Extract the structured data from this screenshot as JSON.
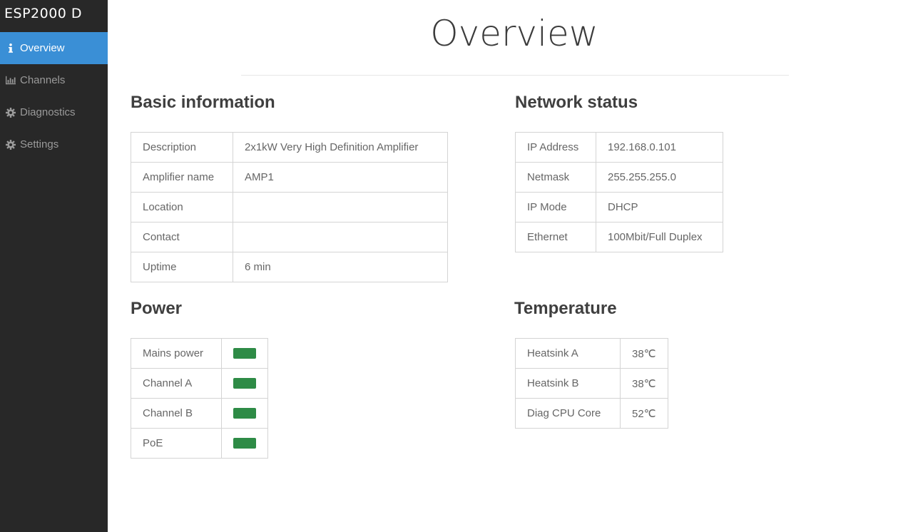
{
  "app": {
    "brand": "ESP2000 D"
  },
  "sidebar": {
    "items": [
      {
        "label": "Overview",
        "icon": "info-icon",
        "active": true
      },
      {
        "label": "Channels",
        "icon": "bar-chart-icon",
        "active": false
      },
      {
        "label": "Diagnostics",
        "icon": "gear-icon",
        "active": false
      },
      {
        "label": "Settings",
        "icon": "gear-icon",
        "active": false
      }
    ]
  },
  "page": {
    "title": "Overview"
  },
  "basic": {
    "title": "Basic information",
    "rows": [
      {
        "label": "Description",
        "value": "2x1kW Very High Definition Amplifier"
      },
      {
        "label": "Amplifier name",
        "value": "AMP1"
      },
      {
        "label": "Location",
        "value": ""
      },
      {
        "label": "Contact",
        "value": ""
      },
      {
        "label": "Uptime",
        "value": "6 min"
      }
    ]
  },
  "network": {
    "title": "Network status",
    "rows": [
      {
        "label": "IP Address",
        "value": "192.168.0.101"
      },
      {
        "label": "Netmask",
        "value": "255.255.255.0"
      },
      {
        "label": "IP Mode",
        "value": "DHCP"
      },
      {
        "label": "Ethernet",
        "value": "100Mbit/Full Duplex"
      }
    ]
  },
  "power": {
    "title": "Power",
    "rows": [
      {
        "label": "Mains power",
        "status": "ok"
      },
      {
        "label": "Channel A",
        "status": "ok"
      },
      {
        "label": "Channel B",
        "status": "ok"
      },
      {
        "label": "PoE",
        "status": "ok"
      }
    ]
  },
  "temperature": {
    "title": "Temperature",
    "rows": [
      {
        "label": "Heatsink A",
        "value": "38℃"
      },
      {
        "label": "Heatsink B",
        "value": "38℃"
      },
      {
        "label": "Diag CPU Core",
        "value": "52℃"
      }
    ]
  },
  "colors": {
    "sidebar_bg": "#282828",
    "active_bg": "#3a8fd6",
    "status_ok": "#2e8b46"
  }
}
